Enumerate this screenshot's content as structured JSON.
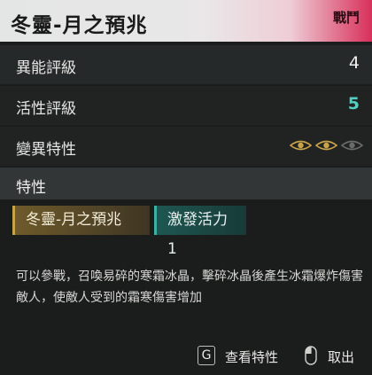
{
  "header": {
    "title": "冬靈-月之預兆",
    "tag": "戰鬥"
  },
  "stats": [
    {
      "label": "異能評級",
      "value": "4"
    },
    {
      "label": "活性評級",
      "value": "5"
    },
    {
      "label": "變異特性"
    }
  ],
  "mutation_level": {
    "filled": 2,
    "total": 3
  },
  "section": {
    "label": "特性"
  },
  "chips": [
    {
      "label": "冬靈-月之預兆"
    },
    {
      "label": "激發活力1"
    }
  ],
  "description": "可以參戰，召喚易碎的寒霜冰晶，擊碎冰晶後產生冰霜爆炸傷害敵人，使敵人受到的霜寒傷害增加",
  "footer": {
    "key": "G",
    "view_label": "查看特性",
    "cancel_label": "取出"
  },
  "colors": {
    "accent": "#4fd0c0",
    "gold": "#c9a34a",
    "header_pink": "#d8305a"
  }
}
